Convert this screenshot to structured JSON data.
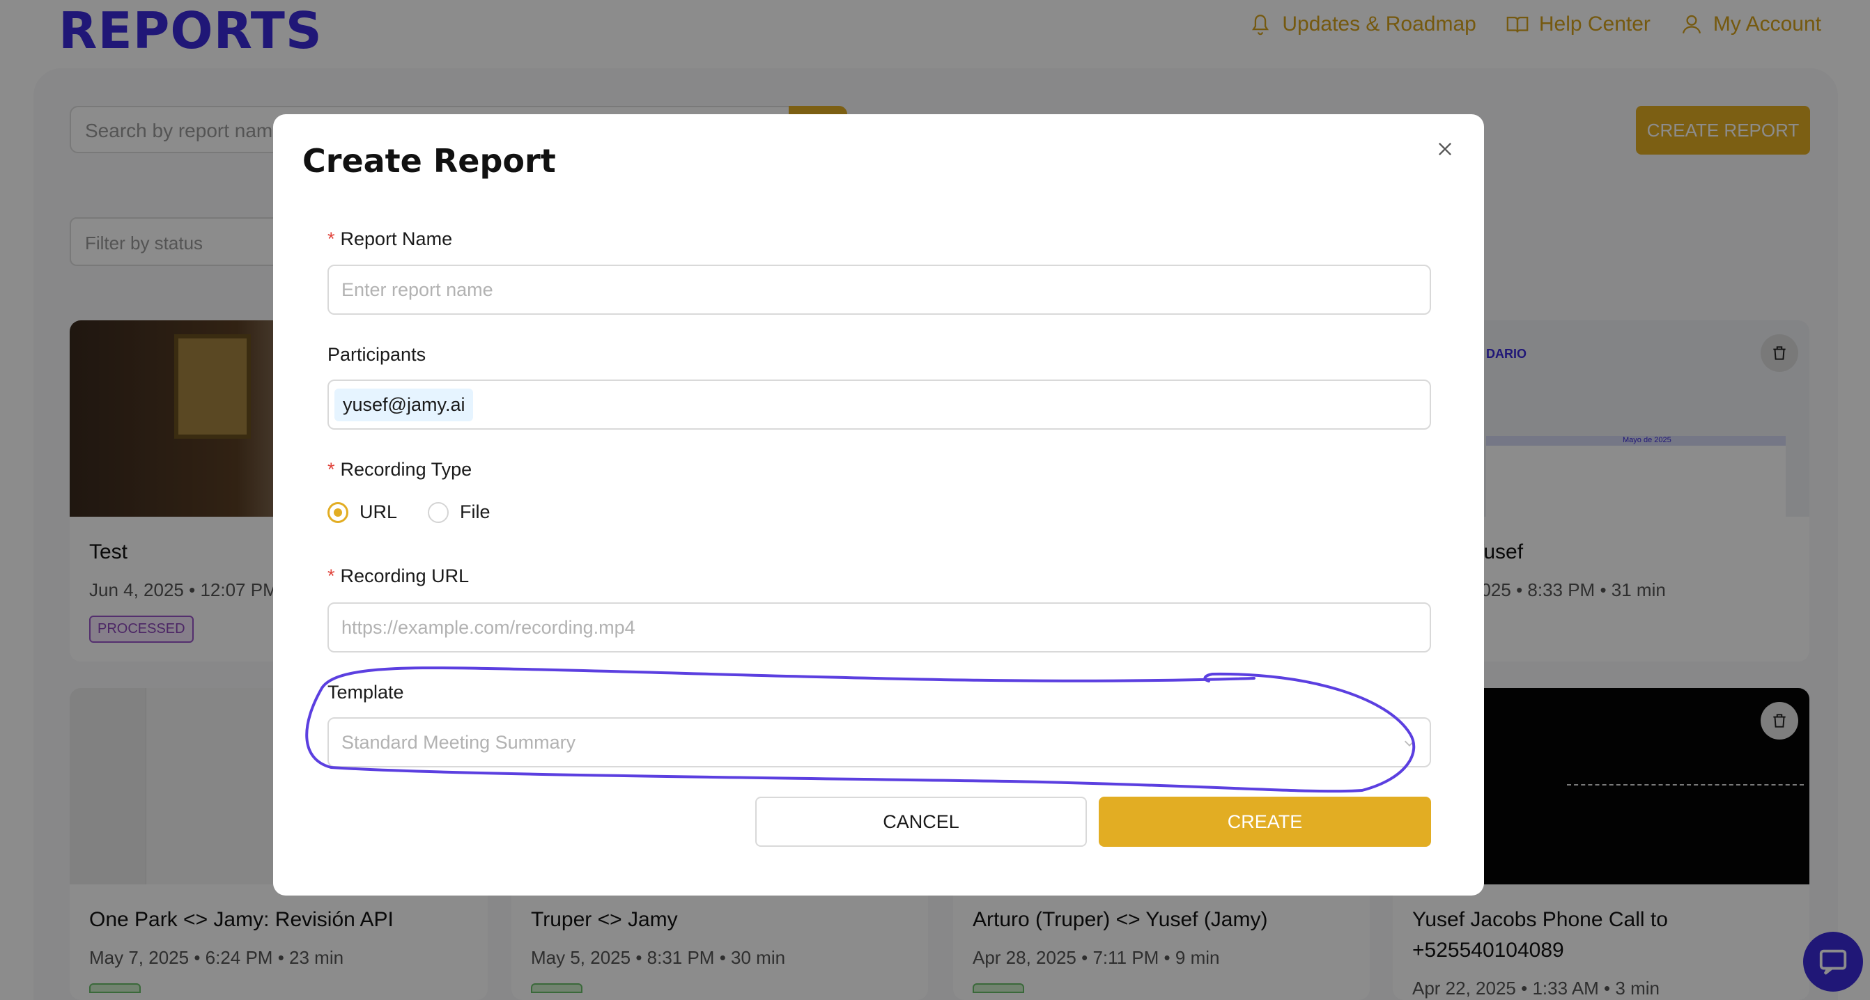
{
  "brand": {
    "logo_text": "REPORTS",
    "accent": "#e2ad23",
    "brand_color": "#3b2ad9"
  },
  "topnav": {
    "items": [
      {
        "label": "Updates & Roadmap",
        "icon": "bell-icon"
      },
      {
        "label": "Help Center",
        "icon": "book-icon"
      },
      {
        "label": "My Account",
        "icon": "user-icon"
      }
    ]
  },
  "toolbar": {
    "search_placeholder": "Search by report name",
    "create_label": "CREATE REPORT",
    "filter_placeholder": "Filter by status"
  },
  "cards": [
    {
      "title": "Test",
      "meta": "Jun 4, 2025 • 12:07 PM",
      "badge": "PROCESSED"
    },
    {
      "title": "Yusef",
      "meta": "2025 • 8:33 PM • 31 min"
    },
    {
      "title": "One Park <> Jamy: Revisión API",
      "meta": "May 7, 2025 • 6:24 PM • 23 min"
    },
    {
      "title": "Truper <> Jamy",
      "meta": "May 5, 2025 • 8:31 PM • 30 min"
    },
    {
      "title": "Arturo (Truper) <> Yusef (Jamy)",
      "meta": "Apr 28, 2025 • 7:11 PM • 9 min"
    },
    {
      "title_line1": "Yusef Jacobs Phone Call to",
      "title_line2": "+525540104089",
      "meta": "Apr 22, 2025 • 1:33 AM • 3 min"
    }
  ],
  "thumb_text": {
    "calendar_brand": "DARIO",
    "calendar_month": "Mayo de 2025"
  },
  "modal": {
    "title": "Create Report",
    "report_name": {
      "label": "Report Name",
      "required_mark": "*",
      "placeholder": "Enter report name"
    },
    "participants": {
      "label": "Participants",
      "tag": "yusef@jamy.ai"
    },
    "recording_type": {
      "label": "Recording Type",
      "required_mark": "*",
      "options": [
        "URL",
        "File"
      ],
      "selected": "URL"
    },
    "recording_url": {
      "label": "Recording URL",
      "required_mark": "*",
      "placeholder": "https://example.com/recording.mp4"
    },
    "template": {
      "label": "Template",
      "value": "Standard Meeting Summary"
    },
    "cancel_label": "CANCEL",
    "create_label": "CREATE"
  }
}
